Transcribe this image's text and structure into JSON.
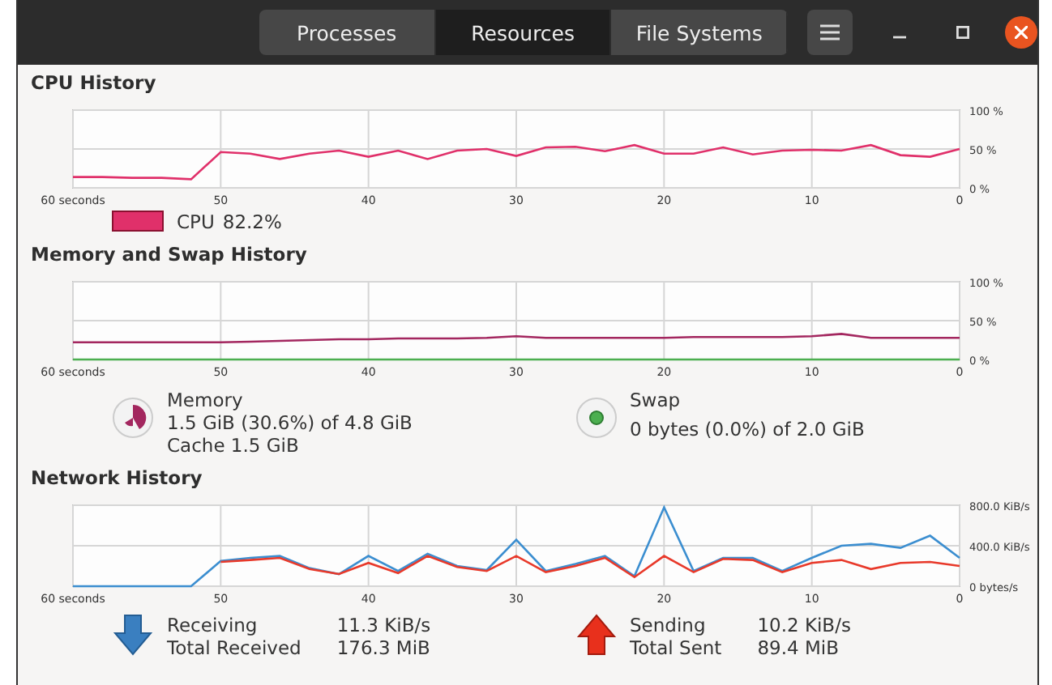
{
  "tabs": [
    {
      "label": "Processes",
      "selected": false
    },
    {
      "label": "Resources",
      "selected": true
    },
    {
      "label": "File Systems",
      "selected": false
    }
  ],
  "cpu": {
    "title": "CPU History",
    "chart_data": {
      "type": "line",
      "x": [
        60,
        58,
        56,
        54,
        52,
        50,
        48,
        46,
        44,
        42,
        40,
        38,
        36,
        34,
        32,
        30,
        28,
        26,
        24,
        22,
        20,
        18,
        16,
        14,
        12,
        10,
        8,
        6,
        4,
        2,
        0
      ],
      "xlim": [
        60,
        0
      ],
      "ylim": [
        0,
        100
      ],
      "grid": true,
      "xticks": [
        {
          "value": 60,
          "label": "60 seconds"
        },
        50,
        40,
        30,
        20,
        10,
        0
      ],
      "yticks": [
        {
          "value": 0,
          "label": "0 %"
        },
        {
          "value": 50,
          "label": "50 %"
        },
        {
          "value": 100,
          "label": "100 %"
        }
      ],
      "series": [
        {
          "name": "CPU",
          "color": "#e0306a",
          "values": [
            14,
            14,
            13,
            13,
            11,
            46,
            44,
            37,
            44,
            48,
            40,
            48,
            37,
            48,
            50,
            41,
            52,
            53,
            47,
            55,
            44,
            44,
            52,
            43,
            48,
            49,
            48,
            55,
            42,
            40,
            50
          ]
        }
      ]
    },
    "legend": {
      "value": "82.2%"
    }
  },
  "memory": {
    "title": "Memory and Swap History",
    "chart_data": {
      "type": "line",
      "x": [
        60,
        58,
        56,
        54,
        52,
        50,
        48,
        46,
        44,
        42,
        40,
        38,
        36,
        34,
        32,
        30,
        28,
        26,
        24,
        22,
        20,
        18,
        16,
        14,
        12,
        10,
        8,
        6,
        4,
        2,
        0
      ],
      "xlim": [
        60,
        0
      ],
      "ylim": [
        0,
        100
      ],
      "grid": true,
      "xticks": [
        {
          "value": 60,
          "label": "60 seconds"
        },
        50,
        40,
        30,
        20,
        10,
        0
      ],
      "yticks": [
        {
          "value": 0,
          "label": "0 %"
        },
        {
          "value": 50,
          "label": "50 %"
        },
        {
          "value": 100,
          "label": "100 %"
        }
      ],
      "series": [
        {
          "name": "Memory",
          "color": "#a3275f",
          "values": [
            22,
            22,
            22,
            22,
            22,
            22,
            23,
            24,
            25,
            26,
            26,
            27,
            27,
            27,
            28,
            30,
            28,
            28,
            28,
            28,
            28,
            29,
            29,
            29,
            29,
            30,
            33,
            28,
            28,
            28,
            28
          ]
        },
        {
          "name": "Swap",
          "color": "#4caf50",
          "values": [
            0,
            0,
            0,
            0,
            0,
            0,
            0,
            0,
            0,
            0,
            0,
            0,
            0,
            0,
            0,
            0,
            0,
            0,
            0,
            0,
            0,
            0,
            0,
            0,
            0,
            0,
            0,
            0,
            0,
            0,
            0
          ]
        }
      ]
    },
    "items": [
      {
        "kind": "memory",
        "lines": [
          "1.5 GiB (30.6%) of 4.8 GiB",
          "Cache 1.5 GiB"
        ]
      },
      {
        "kind": "swap",
        "lines": [
          "0 bytes (0.0%) of 2.0 GiB"
        ]
      }
    ]
  },
  "network": {
    "title": "Network History",
    "chart_data": {
      "type": "line",
      "x": [
        60,
        58,
        56,
        54,
        52,
        50,
        48,
        46,
        44,
        42,
        40,
        38,
        36,
        34,
        32,
        30,
        28,
        26,
        24,
        22,
        20,
        18,
        16,
        14,
        12,
        10,
        8,
        6,
        4,
        2,
        0
      ],
      "xlim": [
        60,
        0
      ],
      "ylim": [
        0,
        800
      ],
      "grid": true,
      "xticks": [
        {
          "value": 60,
          "label": "60 seconds"
        },
        50,
        40,
        30,
        20,
        10,
        0
      ],
      "yticks": [
        {
          "value": 0,
          "label": "0 bytes/s"
        },
        {
          "value": 400,
          "label": "400.0 KiB/s"
        },
        {
          "value": 800,
          "label": "800.0 KiB/s"
        }
      ],
      "series": [
        {
          "name": "Receiving",
          "color": "#3b8ed0",
          "values": [
            0,
            0,
            0,
            0,
            0,
            250,
            280,
            300,
            180,
            120,
            300,
            150,
            320,
            200,
            160,
            460,
            150,
            220,
            300,
            100,
            780,
            150,
            280,
            280,
            150,
            280,
            400,
            420,
            380,
            500,
            280
          ]
        },
        {
          "name": "Sending",
          "color": "#e8392a",
          "values": [
            null,
            null,
            null,
            null,
            null,
            240,
            260,
            280,
            170,
            120,
            230,
            130,
            300,
            190,
            150,
            300,
            140,
            200,
            280,
            90,
            300,
            140,
            270,
            260,
            140,
            230,
            260,
            170,
            230,
            240,
            200
          ]
        }
      ]
    },
    "items": [
      {
        "kind": "receiving",
        "value": "11.3 KiB/s",
        "total_label": "Total Received",
        "total": "176.3 MiB"
      },
      {
        "kind": "sending",
        "value": "10.2 KiB/s",
        "total_label": "Total Sent",
        "total": "89.4 MiB"
      }
    ]
  }
}
